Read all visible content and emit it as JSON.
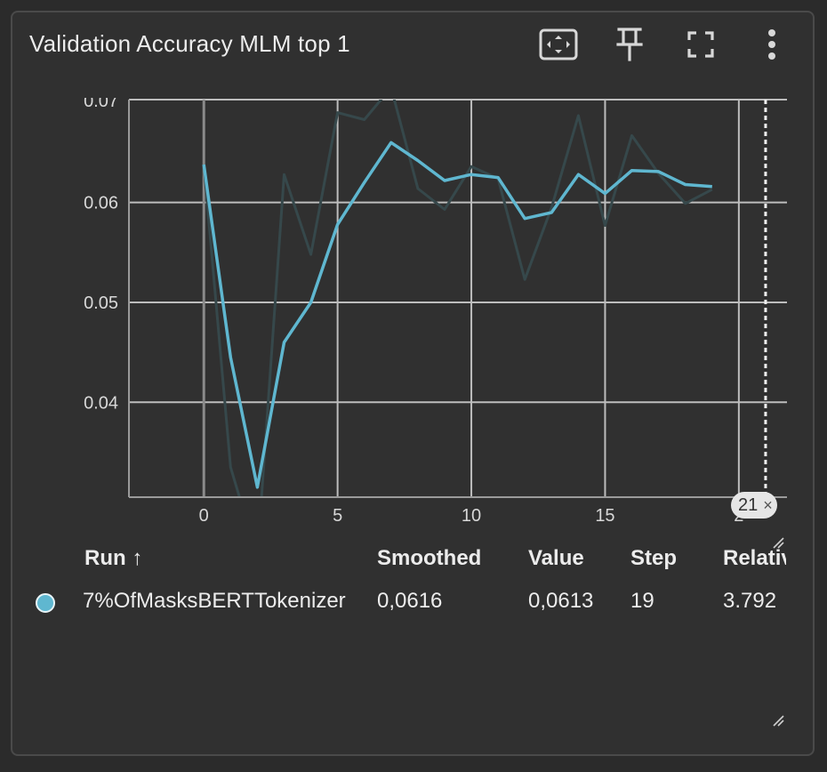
{
  "card": {
    "title": "Validation Accuracy MLM top 1",
    "toolbar": {
      "fit_icon": "fit-domain-icon",
      "pin_icon": "pin-icon",
      "fullscreen_icon": "fullscreen-icon",
      "more_icon": "more-vert-icon"
    },
    "step_badge": {
      "value": "21",
      "icon": "close-icon"
    }
  },
  "chart_data": {
    "type": "line",
    "title": "Validation Accuracy MLM top 1",
    "xlabel": "",
    "ylabel": "",
    "xlim": [
      -2.8,
      21.8
    ],
    "ylim": [
      0.0305,
      0.0703
    ],
    "x_ticks": [
      0,
      5,
      10,
      15,
      20
    ],
    "x_tick_labels": [
      "0",
      "5",
      "10",
      "15",
      "2"
    ],
    "y_ticks": [
      0.04,
      0.05,
      0.06
    ],
    "y_tick_labels": [
      "0.04",
      "0.05",
      "0.06"
    ],
    "y_top_label": "0.07",
    "grid": true,
    "cursor_step": 21,
    "colors": {
      "smoothed": "#5fb7d0",
      "raw": "#36484b"
    },
    "series": [
      {
        "x": [
          0,
          1,
          2,
          3,
          4,
          5,
          6,
          7,
          8,
          9,
          10,
          11,
          12,
          13,
          14,
          15,
          16,
          17,
          18,
          19
        ],
        "raw": [
          0.0638,
          0.0335,
          0.0245,
          0.0628,
          0.0548,
          0.069,
          0.0683,
          0.0715,
          0.0614,
          0.0593,
          0.0636,
          0.0624,
          0.0523,
          0.0595,
          0.0687,
          0.0577,
          0.0667,
          0.0629,
          0.0599,
          0.0613
        ],
        "smoothed": [
          0.0638,
          0.0445,
          0.0315,
          0.046,
          0.05,
          0.0578,
          0.062,
          0.066,
          0.0642,
          0.0622,
          0.0628,
          0.0625,
          0.0584,
          0.059,
          0.0628,
          0.0609,
          0.0632,
          0.0631,
          0.0618,
          0.0616
        ]
      }
    ]
  },
  "table": {
    "headers": {
      "run": "Run ↑",
      "smoothed": "Smoothed",
      "value": "Value",
      "step": "Step",
      "relative": "Relative"
    },
    "rows": [
      {
        "run": "7%OfMasksBERTTokenizer",
        "smoothed": "0,0616",
        "value": "0,0613",
        "step": "19",
        "relative": "3.792"
      }
    ]
  }
}
